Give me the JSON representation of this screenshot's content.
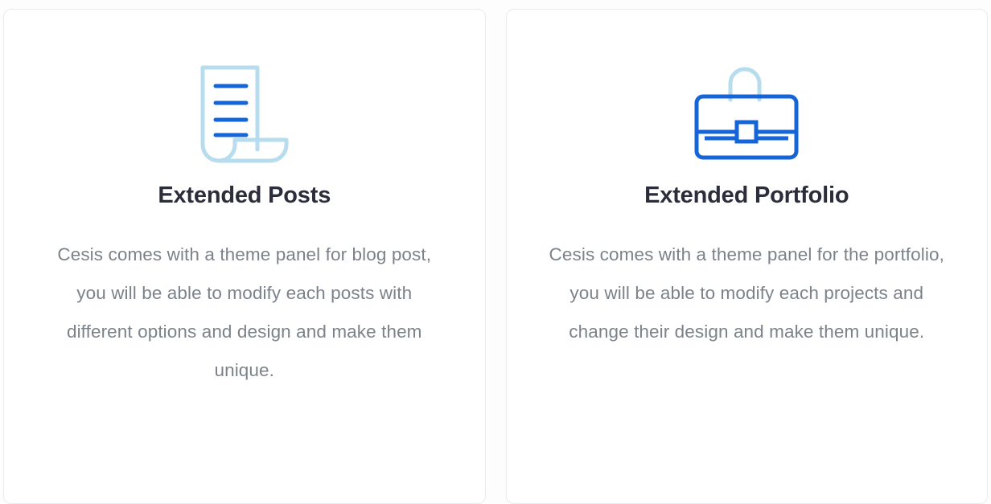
{
  "page": {
    "background_color": "#fdfdfd",
    "card_background_color": "#ffffff",
    "card_border_color": "#e8eaec",
    "title_color": "#2b2d3a",
    "description_color": "#7c828a",
    "icon_primary_color": "#1565d8",
    "icon_secondary_color": "#b6dcee"
  },
  "cards": [
    {
      "icon_name": "document-scroll-icon",
      "title": "Extended Posts",
      "description": "Cesis comes with a theme panel for blog post, you will be able to modify each posts with different options and design and make them unique."
    },
    {
      "icon_name": "briefcase-icon",
      "title": "Extended Portfolio",
      "description": "Cesis comes with a theme panel for the portfolio,  you will be able to modify each projects and change their design and make them unique."
    }
  ]
}
